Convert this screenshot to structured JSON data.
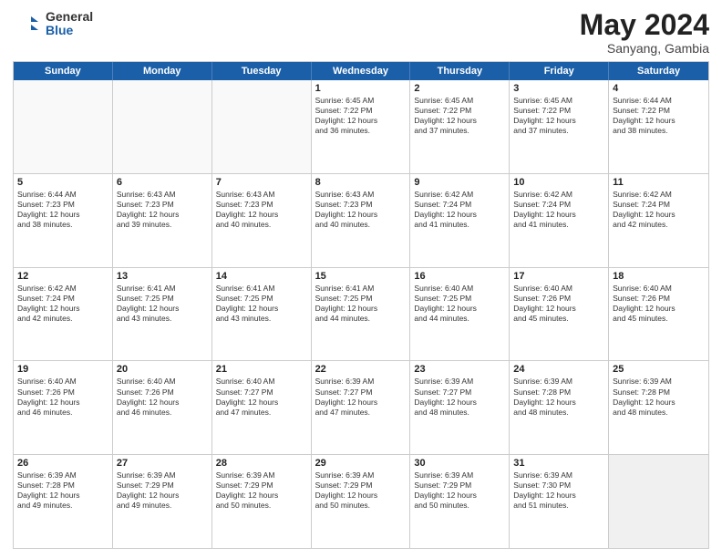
{
  "header": {
    "logo_general": "General",
    "logo_blue": "Blue",
    "month": "May 2024",
    "location": "Sanyang, Gambia"
  },
  "days_of_week": [
    "Sunday",
    "Monday",
    "Tuesday",
    "Wednesday",
    "Thursday",
    "Friday",
    "Saturday"
  ],
  "weeks": [
    [
      {
        "day": "",
        "text": ""
      },
      {
        "day": "",
        "text": ""
      },
      {
        "day": "",
        "text": ""
      },
      {
        "day": "1",
        "text": "Sunrise: 6:45 AM\nSunset: 7:22 PM\nDaylight: 12 hours\nand 36 minutes."
      },
      {
        "day": "2",
        "text": "Sunrise: 6:45 AM\nSunset: 7:22 PM\nDaylight: 12 hours\nand 37 minutes."
      },
      {
        "day": "3",
        "text": "Sunrise: 6:45 AM\nSunset: 7:22 PM\nDaylight: 12 hours\nand 37 minutes."
      },
      {
        "day": "4",
        "text": "Sunrise: 6:44 AM\nSunset: 7:22 PM\nDaylight: 12 hours\nand 38 minutes."
      }
    ],
    [
      {
        "day": "5",
        "text": "Sunrise: 6:44 AM\nSunset: 7:23 PM\nDaylight: 12 hours\nand 38 minutes."
      },
      {
        "day": "6",
        "text": "Sunrise: 6:43 AM\nSunset: 7:23 PM\nDaylight: 12 hours\nand 39 minutes."
      },
      {
        "day": "7",
        "text": "Sunrise: 6:43 AM\nSunset: 7:23 PM\nDaylight: 12 hours\nand 40 minutes."
      },
      {
        "day": "8",
        "text": "Sunrise: 6:43 AM\nSunset: 7:23 PM\nDaylight: 12 hours\nand 40 minutes."
      },
      {
        "day": "9",
        "text": "Sunrise: 6:42 AM\nSunset: 7:24 PM\nDaylight: 12 hours\nand 41 minutes."
      },
      {
        "day": "10",
        "text": "Sunrise: 6:42 AM\nSunset: 7:24 PM\nDaylight: 12 hours\nand 41 minutes."
      },
      {
        "day": "11",
        "text": "Sunrise: 6:42 AM\nSunset: 7:24 PM\nDaylight: 12 hours\nand 42 minutes."
      }
    ],
    [
      {
        "day": "12",
        "text": "Sunrise: 6:42 AM\nSunset: 7:24 PM\nDaylight: 12 hours\nand 42 minutes."
      },
      {
        "day": "13",
        "text": "Sunrise: 6:41 AM\nSunset: 7:25 PM\nDaylight: 12 hours\nand 43 minutes."
      },
      {
        "day": "14",
        "text": "Sunrise: 6:41 AM\nSunset: 7:25 PM\nDaylight: 12 hours\nand 43 minutes."
      },
      {
        "day": "15",
        "text": "Sunrise: 6:41 AM\nSunset: 7:25 PM\nDaylight: 12 hours\nand 44 minutes."
      },
      {
        "day": "16",
        "text": "Sunrise: 6:40 AM\nSunset: 7:25 PM\nDaylight: 12 hours\nand 44 minutes."
      },
      {
        "day": "17",
        "text": "Sunrise: 6:40 AM\nSunset: 7:26 PM\nDaylight: 12 hours\nand 45 minutes."
      },
      {
        "day": "18",
        "text": "Sunrise: 6:40 AM\nSunset: 7:26 PM\nDaylight: 12 hours\nand 45 minutes."
      }
    ],
    [
      {
        "day": "19",
        "text": "Sunrise: 6:40 AM\nSunset: 7:26 PM\nDaylight: 12 hours\nand 46 minutes."
      },
      {
        "day": "20",
        "text": "Sunrise: 6:40 AM\nSunset: 7:26 PM\nDaylight: 12 hours\nand 46 minutes."
      },
      {
        "day": "21",
        "text": "Sunrise: 6:40 AM\nSunset: 7:27 PM\nDaylight: 12 hours\nand 47 minutes."
      },
      {
        "day": "22",
        "text": "Sunrise: 6:39 AM\nSunset: 7:27 PM\nDaylight: 12 hours\nand 47 minutes."
      },
      {
        "day": "23",
        "text": "Sunrise: 6:39 AM\nSunset: 7:27 PM\nDaylight: 12 hours\nand 48 minutes."
      },
      {
        "day": "24",
        "text": "Sunrise: 6:39 AM\nSunset: 7:28 PM\nDaylight: 12 hours\nand 48 minutes."
      },
      {
        "day": "25",
        "text": "Sunrise: 6:39 AM\nSunset: 7:28 PM\nDaylight: 12 hours\nand 48 minutes."
      }
    ],
    [
      {
        "day": "26",
        "text": "Sunrise: 6:39 AM\nSunset: 7:28 PM\nDaylight: 12 hours\nand 49 minutes."
      },
      {
        "day": "27",
        "text": "Sunrise: 6:39 AM\nSunset: 7:29 PM\nDaylight: 12 hours\nand 49 minutes."
      },
      {
        "day": "28",
        "text": "Sunrise: 6:39 AM\nSunset: 7:29 PM\nDaylight: 12 hours\nand 50 minutes."
      },
      {
        "day": "29",
        "text": "Sunrise: 6:39 AM\nSunset: 7:29 PM\nDaylight: 12 hours\nand 50 minutes."
      },
      {
        "day": "30",
        "text": "Sunrise: 6:39 AM\nSunset: 7:29 PM\nDaylight: 12 hours\nand 50 minutes."
      },
      {
        "day": "31",
        "text": "Sunrise: 6:39 AM\nSunset: 7:30 PM\nDaylight: 12 hours\nand 51 minutes."
      },
      {
        "day": "",
        "text": ""
      }
    ]
  ]
}
